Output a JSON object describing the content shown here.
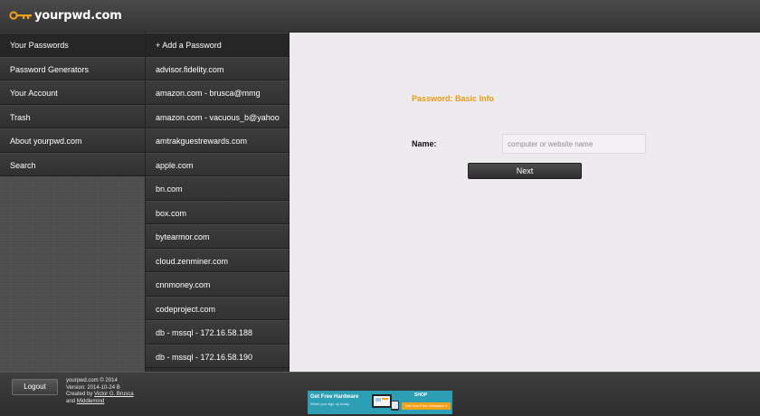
{
  "brand": {
    "name": "yourpwd.com",
    "color": "#f2a21a"
  },
  "nav": {
    "items": [
      {
        "label": "Your Passwords",
        "active": true
      },
      {
        "label": "Password Generators",
        "active": false
      },
      {
        "label": "Your Account",
        "active": false
      },
      {
        "label": "Trash",
        "active": false
      },
      {
        "label": "About yourpwd.com",
        "active": false
      },
      {
        "label": "Search",
        "active": false
      }
    ]
  },
  "passwords": {
    "add_label": "+ Add a Password",
    "items": [
      "advisor.fidelity.com",
      "amazon.com - brusca@mmg",
      "amazon.com - vacuous_b@yahoo",
      "amtrakguestrewards.com",
      "apple.com",
      "bn.com",
      "box.com",
      "bytearmor.com",
      "cloud.zenminer.com",
      "cnnmoney.com",
      "codeproject.com",
      "db - mssql - 172.16.58.188",
      "db - mssql - 172.16.58.190"
    ]
  },
  "form": {
    "section_title": "Password: Basic Info",
    "name_label": "Name:",
    "name_value": "",
    "name_placeholder": "computer or website name",
    "next_label": "Next",
    "accent": "#e89b0f"
  },
  "footer": {
    "logout_label": "Logout",
    "copyright": "yourpwd.com © 2014",
    "version": "Version: 2014-10-24 B",
    "created_by_prefix": "Created by",
    "author": "Victor G. Brusca",
    "and_text": "and",
    "company": "Middlemind"
  },
  "ad": {
    "title": "Get Free Hardware",
    "subtitle": "When you sign up today.",
    "brand": "SHOP",
    "cta": "Get Your Free Hardware »",
    "color": "#2c9fb5"
  }
}
